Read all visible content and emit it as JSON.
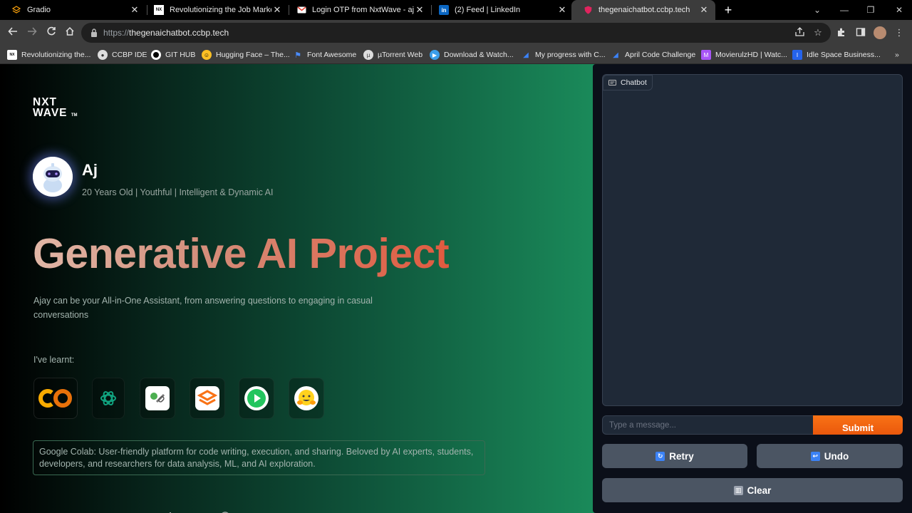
{
  "browser": {
    "tabs": [
      {
        "title": "Gradio",
        "icon": "gradio-icon"
      },
      {
        "title": "Revolutionizing the Job Market |",
        "icon": "nxtwave-icon"
      },
      {
        "title": "Login OTP from NxtWave - ajayr",
        "icon": "gmail-icon"
      },
      {
        "title": "(2) Feed | LinkedIn",
        "icon": "linkedin-icon"
      },
      {
        "title": "thegenaichatbot.ccbp.tech",
        "icon": "shield-icon",
        "active": true
      }
    ],
    "url_scheme": "https://",
    "url_host": "thegenaichatbot.ccbp.tech",
    "bookmarks": [
      "Revolutionizing the...",
      "CCBP IDE",
      "GIT HUB",
      "Hugging Face – The...",
      "Font Awesome",
      "µTorrent Web",
      "Download & Watch...",
      "My progress with C...",
      "April Code Challenge",
      "MovierulzHD | Watc...",
      "Idle Space Business..."
    ]
  },
  "page": {
    "logo_line1": "NXT",
    "logo_line2": "WAVE",
    "logo_tm": "TM",
    "bot_name": "Aj",
    "bot_subtitle": "20 Years Old | Youthful | Intelligent & Dynamic AI",
    "headline": "Generative AI Project",
    "description": "Ajay can be your All-in-One Assistant, from answering questions to engaging in casual conversations",
    "learnt_label": "I've learnt:",
    "skills": [
      {
        "name": "google-colab-icon"
      },
      {
        "name": "openai-icon"
      },
      {
        "name": "langchain-icon"
      },
      {
        "name": "gradio-icon"
      },
      {
        "name": "play-icon"
      },
      {
        "name": "hugging-face-icon"
      }
    ],
    "info_text": "Google Colab: User-friendly platform for code writing, execution, and sharing. Beloved by AI experts, students, developers, and researchers for data analysis, ML, and AI exploration."
  },
  "chat": {
    "label": "Chatbot",
    "input_placeholder": "Type a message...",
    "submit_label": "Submit",
    "retry_label": "Retry",
    "undo_label": "Undo",
    "clear_label": "Clear"
  },
  "colors": {
    "accent_orange": "#f97316",
    "panel_bg": "#0b0f19",
    "button_gray": "#4b5563"
  }
}
